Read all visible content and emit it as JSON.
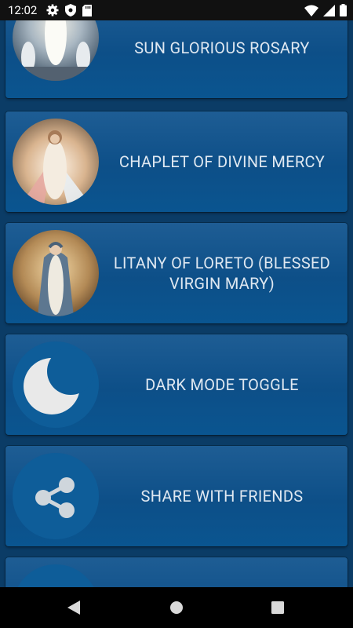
{
  "status_bar": {
    "time": "12:02",
    "icons": [
      "gear-icon",
      "shield-icon",
      "sdcard-icon",
      "wifi-icon",
      "signal-icon",
      "battery-icon"
    ]
  },
  "menu": {
    "items": [
      {
        "label": "SUN GLORIOUS ROSARY",
        "icon": "resurrection-image"
      },
      {
        "label": "CHAPLET OF DIVINE MERCY",
        "icon": "divine-mercy-image"
      },
      {
        "label": "LITANY OF LORETO (BLESSED VIRGIN MARY)",
        "icon": "virgin-mary-image"
      },
      {
        "label": "DARK MODE TOGGLE",
        "icon": "moon-icon"
      },
      {
        "label": "SHARE WITH FRIENDS",
        "icon": "share-icon"
      },
      {
        "label": "",
        "icon": "partial-circle"
      }
    ]
  },
  "colors": {
    "background": "#0b3c66",
    "card_top": "#1e5d94",
    "card_bottom": "#0a5590",
    "label_text": "#dfe8f1",
    "icon_circle": "#0e5d99"
  },
  "nav": {
    "buttons": [
      "back-icon",
      "home-icon",
      "recents-icon"
    ]
  }
}
